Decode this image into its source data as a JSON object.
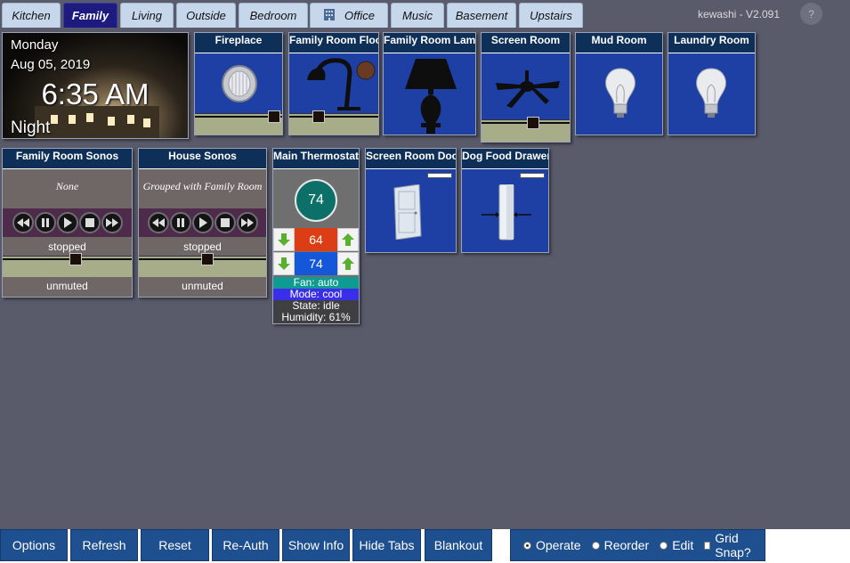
{
  "tabs": [
    {
      "label": "Kitchen",
      "active": false
    },
    {
      "label": "Family",
      "active": true
    },
    {
      "label": "Living",
      "active": false
    },
    {
      "label": "Outside",
      "active": false
    },
    {
      "label": "Bedroom",
      "active": false
    },
    {
      "label": "Office",
      "active": false,
      "icon": "building-icon"
    },
    {
      "label": "Music",
      "active": false
    },
    {
      "label": "Basement",
      "active": false
    },
    {
      "label": "Upstairs",
      "active": false
    }
  ],
  "header": {
    "version": "kewashi - V2.091",
    "help": "?"
  },
  "clock": {
    "day": "Monday",
    "date": "Aug 05, 2019",
    "time": "6:35 AM",
    "mode": "Night"
  },
  "tiles": {
    "fireplace": {
      "title": "Fireplace",
      "icon": "recessed-light-icon",
      "level": 0.98
    },
    "family_room_floor": {
      "title": "Family Room Floor",
      "icon": "floor-lamp-icon",
      "level": 0.3
    },
    "family_room_lamp": {
      "title": "Family Room Lamp",
      "icon": "table-lamp-icon"
    },
    "screen_room": {
      "title": "Screen Room",
      "icon": "ceiling-fan-icon",
      "level": 0.6
    },
    "mud_room": {
      "title": "Mud Room",
      "icon": "light-bulb-icon"
    },
    "laundry_room": {
      "title": "Laundry Room",
      "icon": "light-bulb-icon"
    },
    "screen_room_door": {
      "title": "Screen Room Door",
      "icon": "door-icon"
    },
    "dog_food_drawer": {
      "title": "Dog Food Drawer",
      "icon": "contact-sensor-icon"
    }
  },
  "sonos": [
    {
      "title": "Family Room Sonos",
      "track": "None",
      "status": "stopped",
      "mute": "unmuted",
      "volume": 0.57
    },
    {
      "title": "House Sonos",
      "track": "Grouped with Family Room",
      "status": "stopped",
      "mute": "unmuted",
      "volume": 0.54
    }
  ],
  "thermostat": {
    "title": "Main Thermostat",
    "temperature": "74",
    "heat_setpoint": "64",
    "cool_setpoint": "74",
    "fan": "Fan: auto",
    "mode": "Mode: cool",
    "state": "State: idle",
    "humidity": "Humidity: 61%"
  },
  "buttons": [
    "Options",
    "Refresh",
    "Reset",
    "Re-Auth",
    "Show Info",
    "Hide Tabs",
    "Blankout"
  ],
  "modes": {
    "operate": "Operate",
    "reorder": "Reorder",
    "edit": "Edit",
    "snap": "Grid Snap?",
    "selected": "Operate"
  },
  "colors": {
    "tab_active": "#1d1a80",
    "tile_bg": "#1e40a5",
    "heat": "#dc3d14",
    "cool": "#1457d8",
    "fan": "#0f9a92",
    "mode": "#3b2ee8"
  }
}
